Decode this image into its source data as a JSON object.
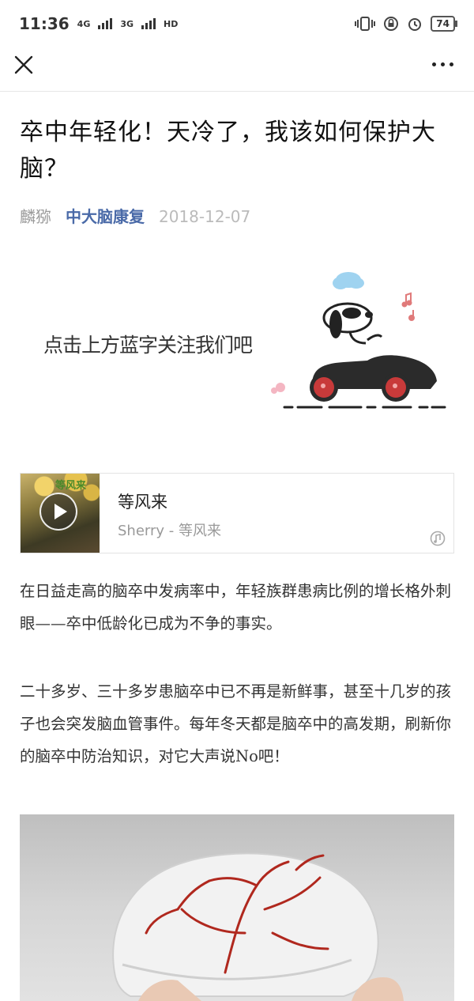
{
  "status_bar": {
    "time": "11:36",
    "net1": "4G",
    "net2": "3G",
    "hd": "HD",
    "battery": "74"
  },
  "article": {
    "title": "卒中年轻化！天冷了，我该如何保护大脑？",
    "author": "麟猕",
    "account": "中大脑康复",
    "date": "2018-12-07"
  },
  "banner": {
    "text": "点击上方蓝字关注我们吧"
  },
  "music": {
    "album_text": "等风来",
    "title": "等风来",
    "artist": "Sherry - 等风来"
  },
  "paragraphs": [
    "在日益走高的脑卒中发病率中，年轻族群患病比例的增长格外刺眼——卒中低龄化已成为不争的事实。",
    "二十多岁、三十多岁患脑卒中已不再是新鲜事，甚至十几岁的孩子也会突发脑血管事件。每年冬天都是脑卒中的高发期，刷新你的脑卒中防治知识，对它大声说No吧！"
  ],
  "colors": {
    "account_link": "#4a6aa8",
    "car_body": "#2b2b2b",
    "wheel": "#c83a3a",
    "brain_vessel": "#b0281e"
  }
}
